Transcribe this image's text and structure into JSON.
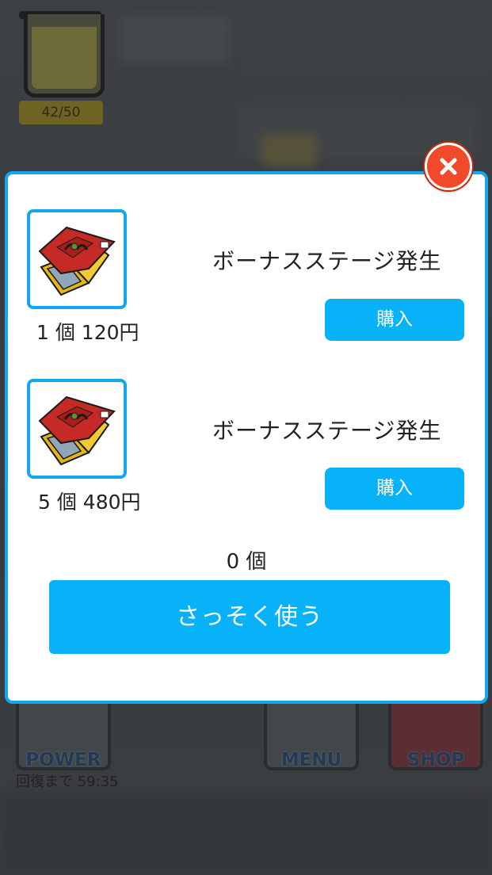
{
  "background": {
    "gauge_counter": "42/50",
    "buttons": [
      {
        "label": "POWER"
      },
      {
        "label": "MENU"
      },
      {
        "label": "SHOP"
      }
    ],
    "recovery_text": "回復まで 59:35"
  },
  "modal": {
    "close_icon": "close-icon",
    "items": [
      {
        "price": "1 個 120円",
        "description": "ボーナスステージ発生",
        "buy_label": "購入"
      },
      {
        "price": "5 個 480円",
        "description": "ボーナスステージ発生",
        "buy_label": "購入"
      }
    ],
    "owned_count": "0 個",
    "use_now_label": "さっそく使う"
  },
  "colors": {
    "accent_blue": "#08b2f8",
    "border_blue": "#12a7ef",
    "close_red": "#f04a2a"
  }
}
